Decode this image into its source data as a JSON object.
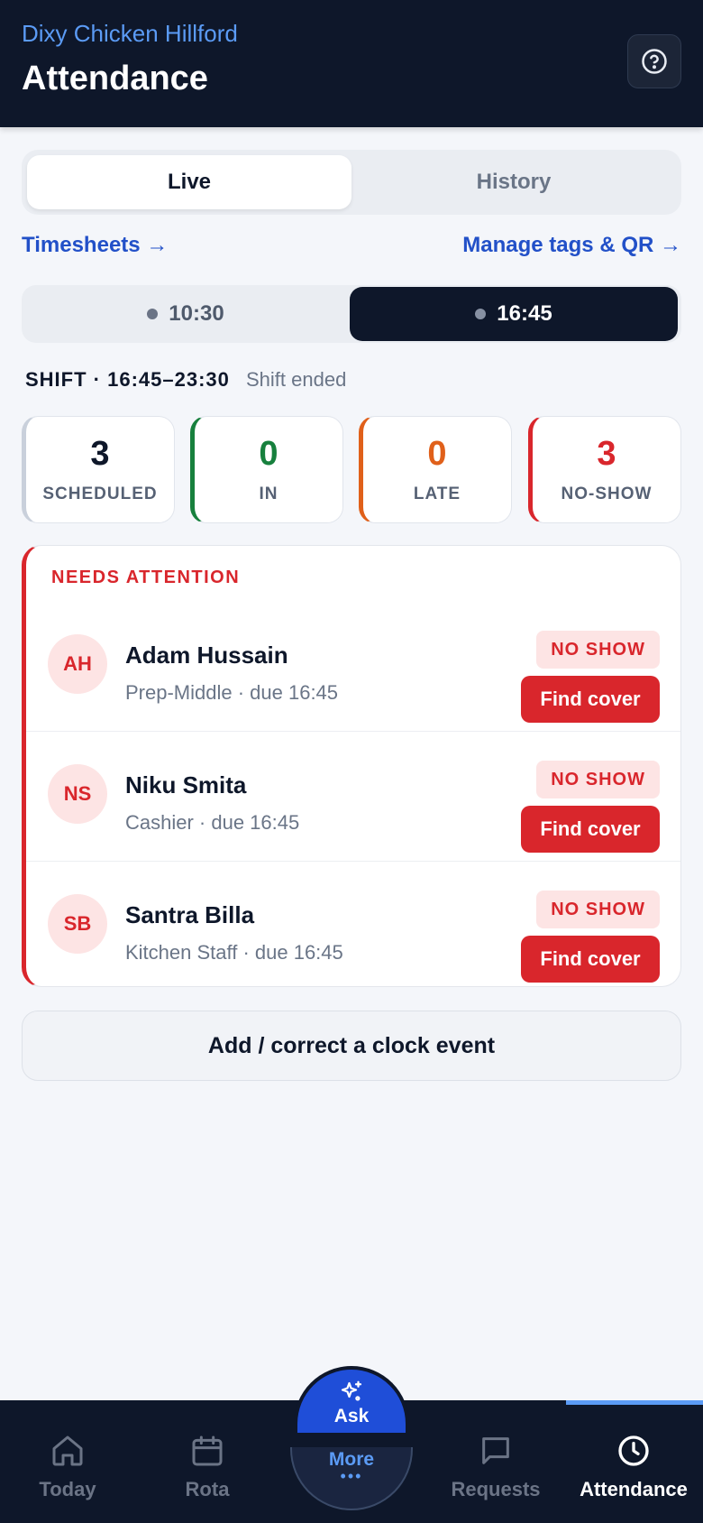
{
  "header": {
    "org": "Dixy Chicken Hillford",
    "title": "Attendance",
    "help_icon": "question-circle-icon"
  },
  "tabs": [
    {
      "label": "Live",
      "active": true
    },
    {
      "label": "History",
      "active": false
    }
  ],
  "links": {
    "timesheets": "Timesheets →",
    "manage": "Manage tags & QR →"
  },
  "shifts": [
    {
      "label": "10:30",
      "active": false
    },
    {
      "label": "16:45",
      "active": true
    }
  ],
  "shift_info": {
    "label": "SHIFT · 16:45–23:30",
    "status": "Shift ended"
  },
  "stats": [
    {
      "value": "3",
      "label": "SCHEDULED",
      "color": "#0e172a",
      "accent": "#c9d0db"
    },
    {
      "value": "0",
      "label": "IN",
      "color": "#17803d",
      "accent": "#17803d"
    },
    {
      "value": "0",
      "label": "LATE",
      "color": "#e0601a",
      "accent": "#e0601a"
    },
    {
      "value": "3",
      "label": "NO-SHOW",
      "color": "#d9262c",
      "accent": "#d9262c"
    }
  ],
  "attention": {
    "title": "NEEDS ATTENTION",
    "rows": [
      {
        "initials": "AH",
        "name": "Adam Hussain",
        "meta": "Prep-Middle · due 16:45",
        "badge": "NO SHOW",
        "action": "Find cover"
      },
      {
        "initials": "NS",
        "name": "Niku Smita",
        "meta": "Cashier · due 16:45",
        "badge": "NO SHOW",
        "action": "Find cover"
      },
      {
        "initials": "SB",
        "name": "Santra Billa",
        "meta": "Kitchen Staff · due 16:45",
        "badge": "NO SHOW",
        "action": "Find cover"
      }
    ]
  },
  "add_button": "Add / correct a clock event",
  "nav": {
    "ask": "Ask",
    "more": "More",
    "more_dots": "•••",
    "items": [
      {
        "label": "Today",
        "icon": "home-icon",
        "active": false
      },
      {
        "label": "Rota",
        "icon": "calendar-icon",
        "active": false
      },
      {
        "label": "Requests",
        "icon": "chat-bubble-icon",
        "active": false
      },
      {
        "label": "Attendance",
        "icon": "clock-icon",
        "active": true
      }
    ]
  }
}
